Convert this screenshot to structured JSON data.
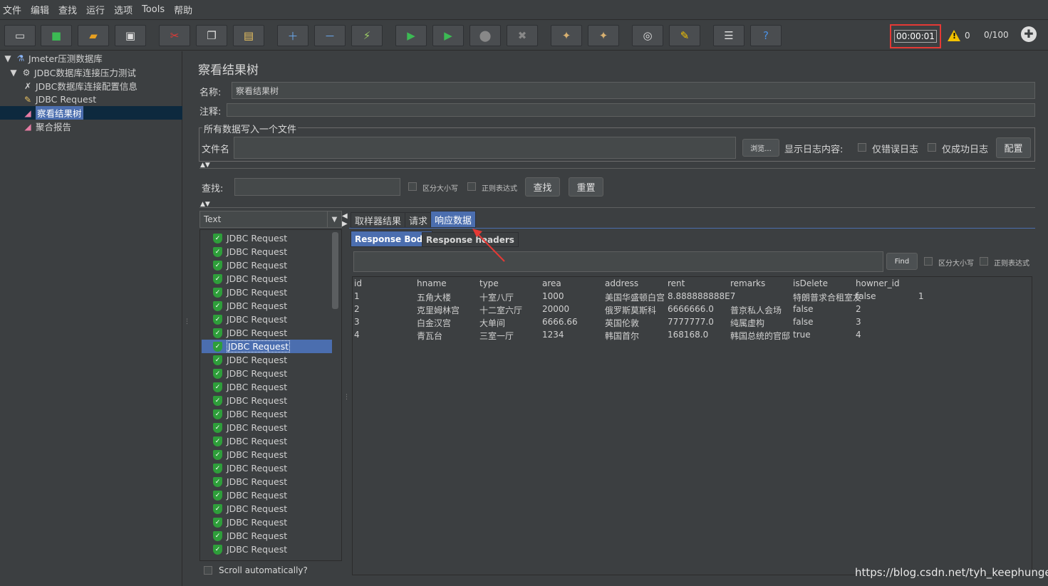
{
  "menu": [
    "文件",
    "编辑",
    "查找",
    "运行",
    "选项",
    "Tools",
    "帮助"
  ],
  "toolbar": {
    "timer": "00:00:01",
    "warnings": "0",
    "threads": "0/100"
  },
  "tree": {
    "root": "Jmeter压测数据库",
    "group": "JDBC数据库连接压力测试",
    "items": [
      "JDBC数据库连接配置信息",
      "JDBC Request",
      "察看结果树",
      "聚合报告"
    ]
  },
  "panel": {
    "title": "察看结果树",
    "name_label": "名称:",
    "name_value": "察看结果树",
    "comment_label": "注释:",
    "file_group": "所有数据写入一个文件",
    "file_label": "文件名",
    "browse": "浏览...",
    "log_label": "显示日志内容:",
    "errors_only": "仅错误日志",
    "success_only": "仅成功日志",
    "config": "配置",
    "search_label": "查找:",
    "case_sensitive": "区分大小写",
    "regex": "正则表达式",
    "search_btn": "查找",
    "reset_btn": "重置",
    "renderer": "Text",
    "scroll_auto": "Scroll automatically?"
  },
  "results": {
    "label": "JDBC Request",
    "count": 24,
    "selected_index": 8
  },
  "tabs": [
    "取样器结果",
    "请求",
    "响应数据"
  ],
  "subtabs": [
    "Response Body",
    "Response headers"
  ],
  "find": {
    "btn": "Find",
    "case": "区分大小写",
    "regex": "正则表达式"
  },
  "table": {
    "headers": [
      "id",
      "hname",
      "type",
      "area",
      "address",
      "rent",
      "remarks",
      "isDelete",
      "howner_id"
    ],
    "rows": [
      [
        "1",
        "五角大楼",
        "十室八厅",
        "1000",
        "美国华盛顿白宫",
        "8.888888888E7",
        "",
        "特朗普求合租室友",
        "false",
        "1"
      ],
      [
        "2",
        "克里姆林宫",
        "十二室六厅",
        "20000",
        "俄罗斯莫斯科",
        "6666666.0",
        "普京私人会场",
        "false",
        "2"
      ],
      [
        "3",
        "白金汉宫",
        "大单间",
        "6666.66",
        "英国伦敦",
        "7777777.0",
        "纯属虚构",
        "false",
        "3"
      ],
      [
        "4",
        "青瓦台",
        "三室一厅",
        "1234",
        "韩国首尔",
        "168168.0",
        "韩国总统的官邸",
        "true",
        "4"
      ]
    ]
  },
  "watermark": "https://blog.csdn.net/tyh_keephunger",
  "colors": {
    "bg": "#3c3f41",
    "selection": "#4b6eaf",
    "timer_border": "#e53935",
    "shield": "#2e9e3a"
  }
}
